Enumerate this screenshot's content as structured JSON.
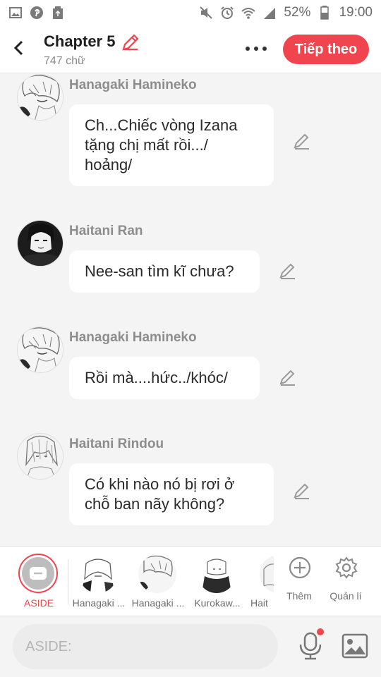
{
  "status_bar": {
    "battery": "52%",
    "time": "19:00",
    "left_icons": [
      "gallery-icon",
      "pinterest-icon",
      "recycle-icon"
    ],
    "right_icons": [
      "mute-icon",
      "alarm-icon",
      "wifi-icon",
      "signal-icon",
      "battery-icon"
    ]
  },
  "header": {
    "title": "Chapter 5",
    "word_count": "747 chữ",
    "next_label": "Tiếp theo",
    "accent_color": "#f0454e"
  },
  "messages": [
    {
      "name": "Hanagaki Hamineko",
      "text_lines": [
        "Ch...Chiếc vòng Izana",
        "tặng chị mất rồi.../",
        "hoảng/"
      ]
    },
    {
      "name": "Haitani Ran",
      "text_lines": [
        "Nee-san tìm kĩ chưa?"
      ]
    },
    {
      "name": "Hanagaki Hamineko",
      "text_lines": [
        "Rồi mà....hức../khóc/"
      ]
    },
    {
      "name": "Haitani Rindou",
      "text_lines": [
        "Có khi nào nó bị rơi ở",
        "chỗ ban nãy không?"
      ]
    }
  ],
  "character_bar": {
    "aside_label": "ASIDE",
    "characters": [
      "Hanagaki ...",
      "Hanagaki ...",
      "Kurokaw...",
      "Hait"
    ],
    "add_label": "Thêm",
    "manage_label": "Quản lí"
  },
  "input": {
    "placeholder": "ASIDE:"
  }
}
